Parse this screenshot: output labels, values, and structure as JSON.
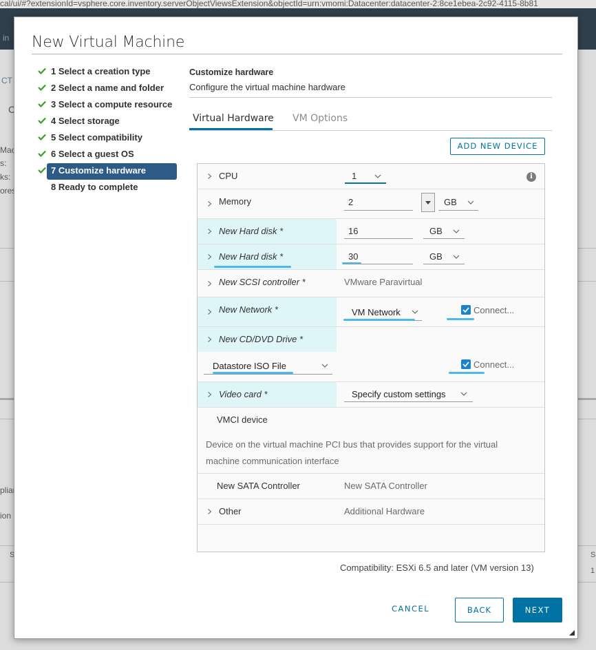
{
  "browser": {
    "url": "cal/ui/#?extensionId=vsphere.core.inventory.serverObjectViewsExtension&objectId=urn:vmomi:Datacenter:datacenter-2:8ce1ebea-2c92-4115-8b81"
  },
  "background": {
    "fragments": [
      "in",
      "CT",
      "C",
      "Mac",
      "s:",
      "ks:",
      "ores",
      "plian",
      "ion",
      "S",
      "S",
      "1"
    ]
  },
  "dialog": {
    "title": "New Virtual Machine",
    "steps": [
      {
        "label": "1 Select a creation type",
        "state": "done"
      },
      {
        "label": "2 Select a name and folder",
        "state": "done"
      },
      {
        "label": "3 Select a compute resource",
        "state": "done"
      },
      {
        "label": "4 Select storage",
        "state": "done"
      },
      {
        "label": "5 Select compatibility",
        "state": "done"
      },
      {
        "label": "6 Select a guest OS",
        "state": "done"
      },
      {
        "label": "7 Customize hardware",
        "state": "active"
      },
      {
        "label": "8 Ready to complete",
        "state": "pending"
      }
    ],
    "section_title": "Customize hardware",
    "section_subtitle": "Configure the virtual machine hardware",
    "tabs": [
      {
        "label": "Virtual Hardware",
        "active": true
      },
      {
        "label": "VM Options",
        "active": false
      }
    ],
    "add_device_label": "ADD NEW DEVICE",
    "hardware": {
      "cpu": {
        "label": "CPU",
        "value": "1"
      },
      "memory": {
        "label": "Memory",
        "value": "2",
        "unit": "GB"
      },
      "hard_disk_1": {
        "label": "New Hard disk *",
        "value": "16",
        "unit": "GB"
      },
      "hard_disk_2": {
        "label": "New Hard disk *",
        "value": "30",
        "unit": "GB"
      },
      "scsi": {
        "label": "New SCSI controller *",
        "value": "VMware Paravirtual"
      },
      "network": {
        "label": "New Network *",
        "value": "VM Network",
        "connect_label": "Connect...",
        "connected": true
      },
      "cdrom": {
        "label": "New CD/DVD Drive *",
        "value": "Datastore ISO File",
        "connect_label": "Connect...",
        "connected": true
      },
      "video": {
        "label": "Video card *",
        "value": "Specify custom settings"
      },
      "vmci": {
        "label": "VMCI device",
        "description_line1": "Device on the virtual machine PCI bus that provides support for the virtual",
        "description_line2": "machine communication interface"
      },
      "sata": {
        "label": "New SATA Controller",
        "value": "New SATA Controller"
      },
      "other": {
        "label": "Other",
        "value": "Additional Hardware"
      }
    },
    "compatibility": "Compatibility: ESXi 6.5 and later (VM version 13)",
    "buttons": {
      "cancel": "CANCEL",
      "back": "BACK",
      "next": "NEXT"
    },
    "colors": {
      "accent": "#0072a3",
      "active_step": "#2d5a86",
      "highlight_row": "#def6f8",
      "check": "#3c9a2c",
      "checkbox": "#1a83c9",
      "annotation": "#49b9ef"
    }
  }
}
